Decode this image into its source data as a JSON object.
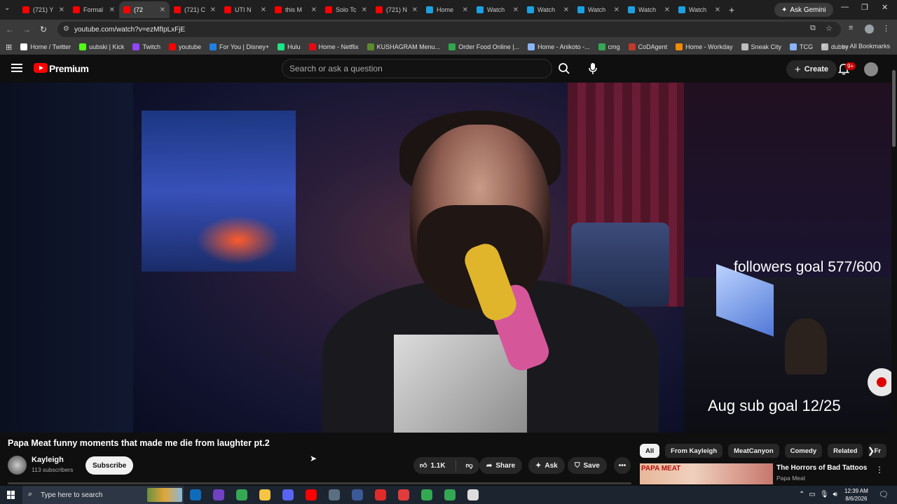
{
  "browser": {
    "tabs": [
      {
        "title": "(721) Y",
        "color": "#ff0000"
      },
      {
        "title": "Formal",
        "color": "#ff0000"
      },
      {
        "title": "(72",
        "color": "#ff0000",
        "active": true
      },
      {
        "title": "(721) C",
        "color": "#ff0000"
      },
      {
        "title": "UTI N",
        "color": "#ff0000"
      },
      {
        "title": "this M",
        "color": "#ff0000"
      },
      {
        "title": "Solo Tc",
        "color": "#ff0000"
      },
      {
        "title": "(721) N",
        "color": "#ff0000"
      },
      {
        "title": "Home",
        "color": "#1ba1e2"
      },
      {
        "title": "Watch",
        "color": "#1ba1e2"
      },
      {
        "title": "Watch",
        "color": "#1ba1e2"
      },
      {
        "title": "Watch",
        "color": "#1ba1e2"
      },
      {
        "title": "Watch",
        "color": "#1ba1e2"
      },
      {
        "title": "Watch",
        "color": "#1ba1e2"
      }
    ],
    "gemini_label": "Ask Gemini",
    "url": "youtube.com/watch?v=ezMfIpLxFjE",
    "bookmarks": [
      {
        "label": "Home / Twitter",
        "color": "#ffffff"
      },
      {
        "label": "uubski | Kick",
        "color": "#53fc18"
      },
      {
        "label": "Twitch",
        "color": "#9146ff"
      },
      {
        "label": "youtube",
        "color": "#ff0000"
      },
      {
        "label": "For You | Disney+",
        "color": "#1f80e0"
      },
      {
        "label": "Hulu",
        "color": "#1ce783"
      },
      {
        "label": "Home - Netflix",
        "color": "#e50914"
      },
      {
        "label": "KUSHAGRAM Menu...",
        "color": "#5c8a2e"
      },
      {
        "label": "Order Food Online |...",
        "color": "#2da84a"
      },
      {
        "label": "Home - Anikoto -...",
        "color": "#8ab4f8"
      },
      {
        "label": "cmg",
        "color": "#34a853"
      },
      {
        "label": "CoDAgent",
        "color": "#c0392b"
      },
      {
        "label": "Home - Workday",
        "color": "#f38b00"
      },
      {
        "label": "Sneak City",
        "color": "#bdbdbd"
      },
      {
        "label": "TCG",
        "color": "#8ab4f8"
      },
      {
        "label": "dubby",
        "color": "#bdbdbd"
      }
    ],
    "all_bookmarks": "All Bookmarks"
  },
  "youtube": {
    "brand": "Premium",
    "search_placeholder": "Search or ask a question",
    "create_label": "Create",
    "notif_count": "9+"
  },
  "overlay": {
    "followers_goal": "followers goal 577/600",
    "sub_goal": "Aug sub goal 12/25"
  },
  "video": {
    "title": "Papa Meat funny moments that made me die from laughter pt.2",
    "channel": "Kayleigh",
    "subscribers": "113 subscribers",
    "subscribe_label": "Subscribe",
    "likes": "1.1K",
    "share_label": "Share",
    "ask_label": "Ask",
    "save_label": "Save"
  },
  "chips": [
    "All",
    "From Kayleigh",
    "MeatCanyon",
    "Comedy",
    "Related",
    "Fr"
  ],
  "recommendation": {
    "title": "The Horrors of Bad Tattoos",
    "channel": "Papa Meat",
    "thumb_text": "PAPA MEAT"
  },
  "taskbar": {
    "search_placeholder": "Type here to search",
    "time": "12:39 AM",
    "date": "8/6/2026",
    "apps": [
      {
        "name": "outlook",
        "color": "#0f6cbd"
      },
      {
        "name": "chrome-alt",
        "color": "#6f42c1"
      },
      {
        "name": "chrome",
        "color": "#34a853"
      },
      {
        "name": "file-explorer",
        "color": "#f6c343"
      },
      {
        "name": "discord",
        "color": "#5865f2"
      },
      {
        "name": "youtube",
        "color": "#ff0000"
      },
      {
        "name": "steam",
        "color": "#5b6f82"
      },
      {
        "name": "app-blue",
        "color": "#3b5998"
      },
      {
        "name": "roblox",
        "color": "#e02b2b"
      },
      {
        "name": "adobe",
        "color": "#e23b3b"
      },
      {
        "name": "chrome-2",
        "color": "#34a853"
      },
      {
        "name": "chrome-3",
        "color": "#34a853"
      },
      {
        "name": "clock",
        "color": "#dddddd"
      }
    ]
  }
}
